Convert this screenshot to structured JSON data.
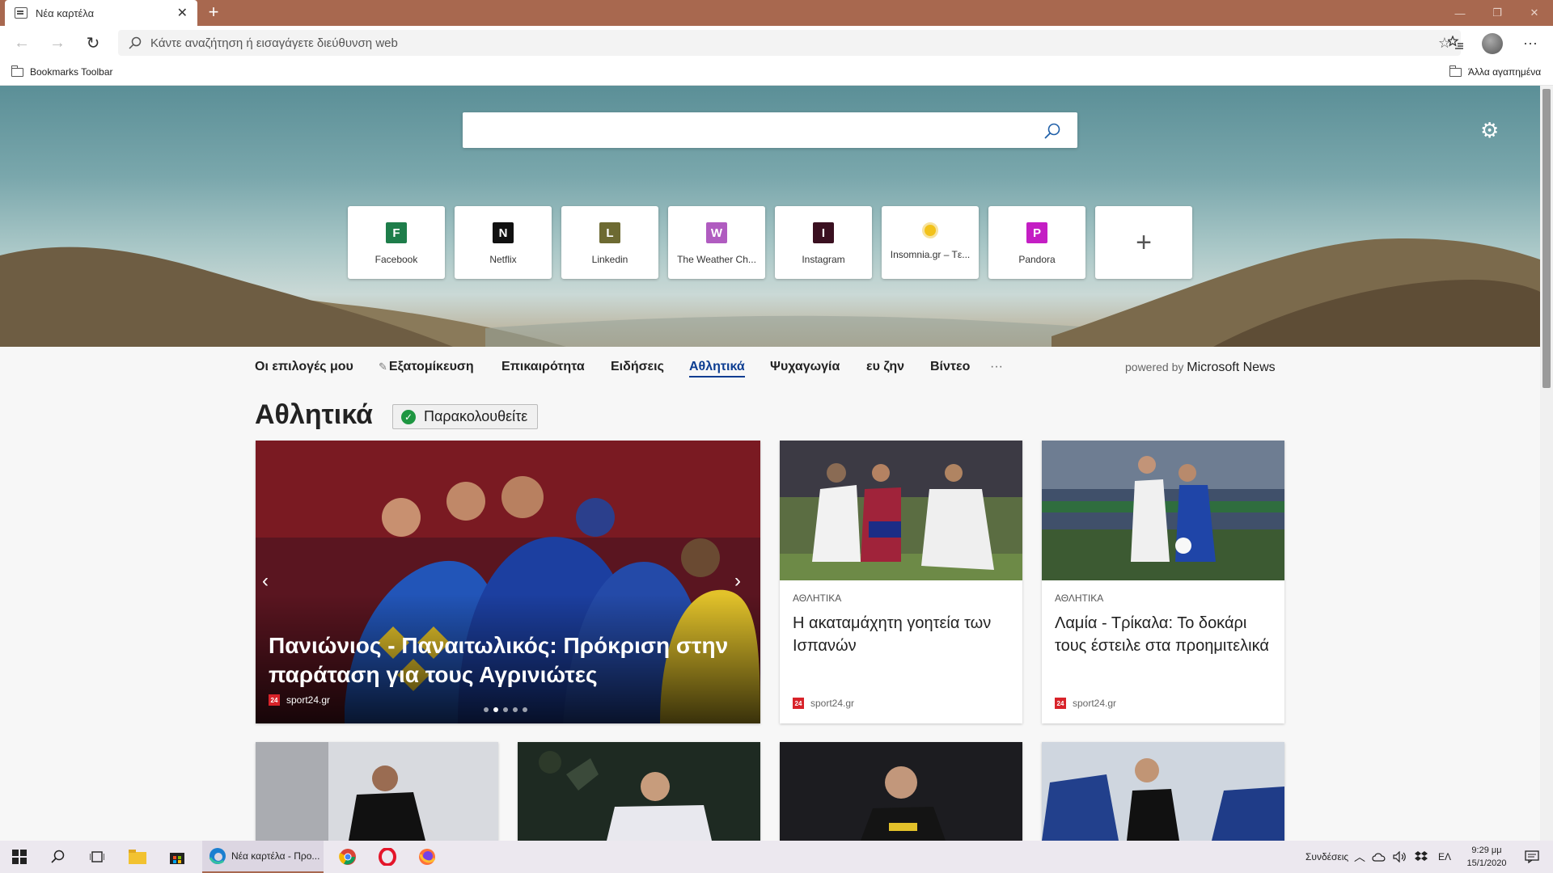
{
  "browser": {
    "tab_title": "Νέα καρτέλα",
    "address_placeholder": "Κάντε αναζήτηση ή εισαγάγετε διεύθυνση web",
    "bookmarks_toolbar_label": "Bookmarks Toolbar",
    "other_favorites_label": "Άλλα αγαπημένα",
    "accent_color": "#a8684f"
  },
  "new_tab": {
    "quick_links": [
      {
        "letter": "F",
        "label": "Facebook",
        "color": "#1e7d4a"
      },
      {
        "letter": "N",
        "label": "Netflix",
        "color": "#111111"
      },
      {
        "letter": "L",
        "label": "Linkedin",
        "color": "#6d6a32"
      },
      {
        "letter": "W",
        "label": "The Weather Ch...",
        "color": "#b05cc0"
      },
      {
        "letter": "I",
        "label": "Instagram",
        "color": "#3a1020"
      },
      {
        "letter": "",
        "label": "Insomnia.gr – Tε...",
        "color": "#f2c21a"
      },
      {
        "letter": "P",
        "label": "Pandora",
        "color": "#c41ec4"
      }
    ]
  },
  "news": {
    "nav": [
      "Οι επιλογές μου",
      "Εξατομίκευση",
      "Επικαιρότητα",
      "Ειδήσεις",
      "Αθλητικά",
      "Ψυχαγωγία",
      "ευ ζην",
      "Βίντεο",
      "···"
    ],
    "active_nav": "Αθλητικά",
    "powered_by": "powered by",
    "provider": "Microsoft News",
    "section_title": "Αθλητικά",
    "follow_label": "Παρακολουθείτε",
    "hero": {
      "title": "Πανιώνιος - Παναιτωλικός: Πρόκριση στην παράταση για τους Αγρινιώτες",
      "source": "sport24.gr"
    },
    "cards": [
      {
        "category": "ΑΘΛΗΤΙΚΑ",
        "title": "Η ακαταμάχητη γοητεία των Ισπανών",
        "source": "sport24.gr"
      },
      {
        "category": "ΑΘΛΗΤΙΚΑ",
        "title": "Λαμία - Τρίκαλα: Το δοκάρι τους έστειλε στα προημιτελικά",
        "source": "sport24.gr"
      }
    ],
    "source_logo_text": "24"
  },
  "taskbar": {
    "active_app_label": "Νέα καρτέλα - Προ...",
    "tray_connections": "Συνδέσεις",
    "language": "ΕΛ",
    "time": "9:29 μμ",
    "date": "15/1/2020"
  }
}
